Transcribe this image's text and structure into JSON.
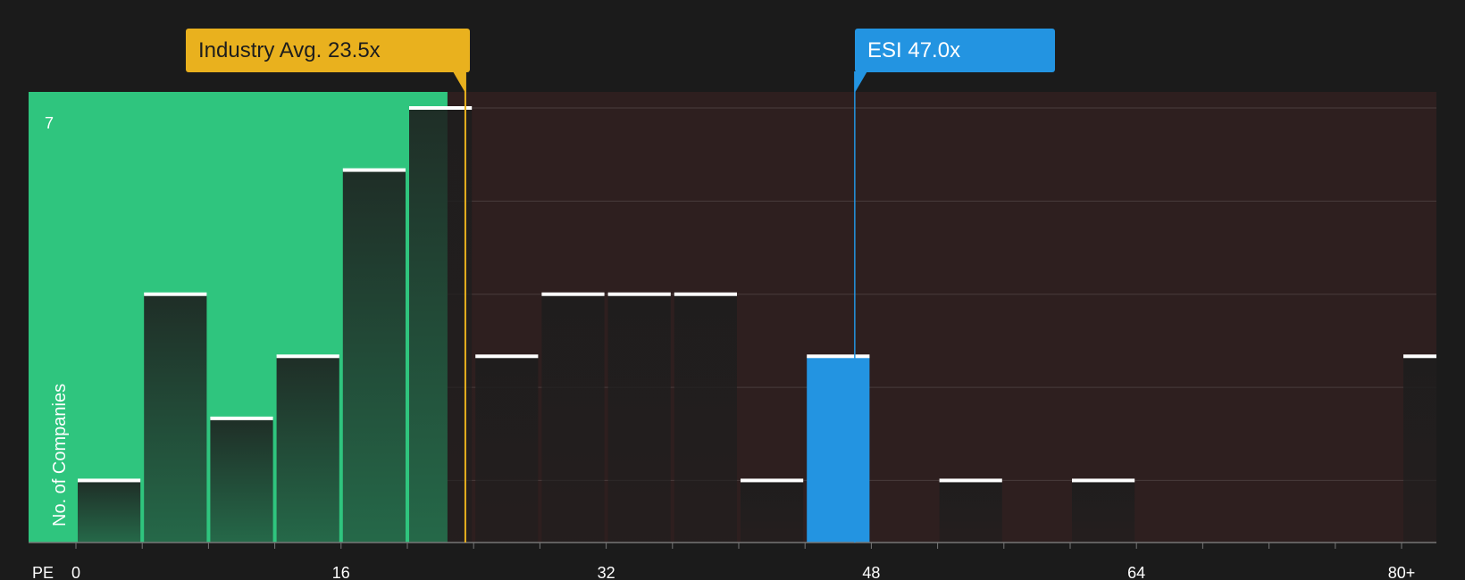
{
  "chart_data": {
    "type": "bar",
    "xlabel": "PE",
    "ylabel": "No. of Companies",
    "x_ticks": [
      "0",
      "16",
      "32",
      "48",
      "64",
      "80+"
    ],
    "y_max_label": "7",
    "ylim": [
      0,
      7
    ],
    "bins": [
      {
        "x_start": 0,
        "x_end": 4,
        "count": 1
      },
      {
        "x_start": 4,
        "x_end": 8,
        "count": 4
      },
      {
        "x_start": 8,
        "x_end": 12,
        "count": 2
      },
      {
        "x_start": 12,
        "x_end": 16,
        "count": 3
      },
      {
        "x_start": 16,
        "x_end": 20,
        "count": 6
      },
      {
        "x_start": 20,
        "x_end": 24,
        "count": 7
      },
      {
        "x_start": 24,
        "x_end": 28,
        "count": 3
      },
      {
        "x_start": 28,
        "x_end": 32,
        "count": 4
      },
      {
        "x_start": 32,
        "x_end": 36,
        "count": 4
      },
      {
        "x_start": 36,
        "x_end": 40,
        "count": 4
      },
      {
        "x_start": 40,
        "x_end": 44,
        "count": 1
      },
      {
        "x_start": 44,
        "x_end": 48,
        "count": 3,
        "highlight": true
      },
      {
        "x_start": 52,
        "x_end": 56,
        "count": 1
      },
      {
        "x_start": 60,
        "x_end": 64,
        "count": 1
      },
      {
        "x_start": 80,
        "x_end": 84,
        "count": 3
      }
    ],
    "industry_avg": {
      "label": "Industry Avg. 23.5x",
      "value": 23.5
    },
    "company": {
      "label": "ESI 47.0x",
      "value": 47.0
    },
    "colors": {
      "below_avg_region": "#2fc57e",
      "above_avg_region": "#2e1f1f",
      "industry": "#e9b11e",
      "company": "#2394e1",
      "bar_cap": "#ffffff"
    }
  }
}
